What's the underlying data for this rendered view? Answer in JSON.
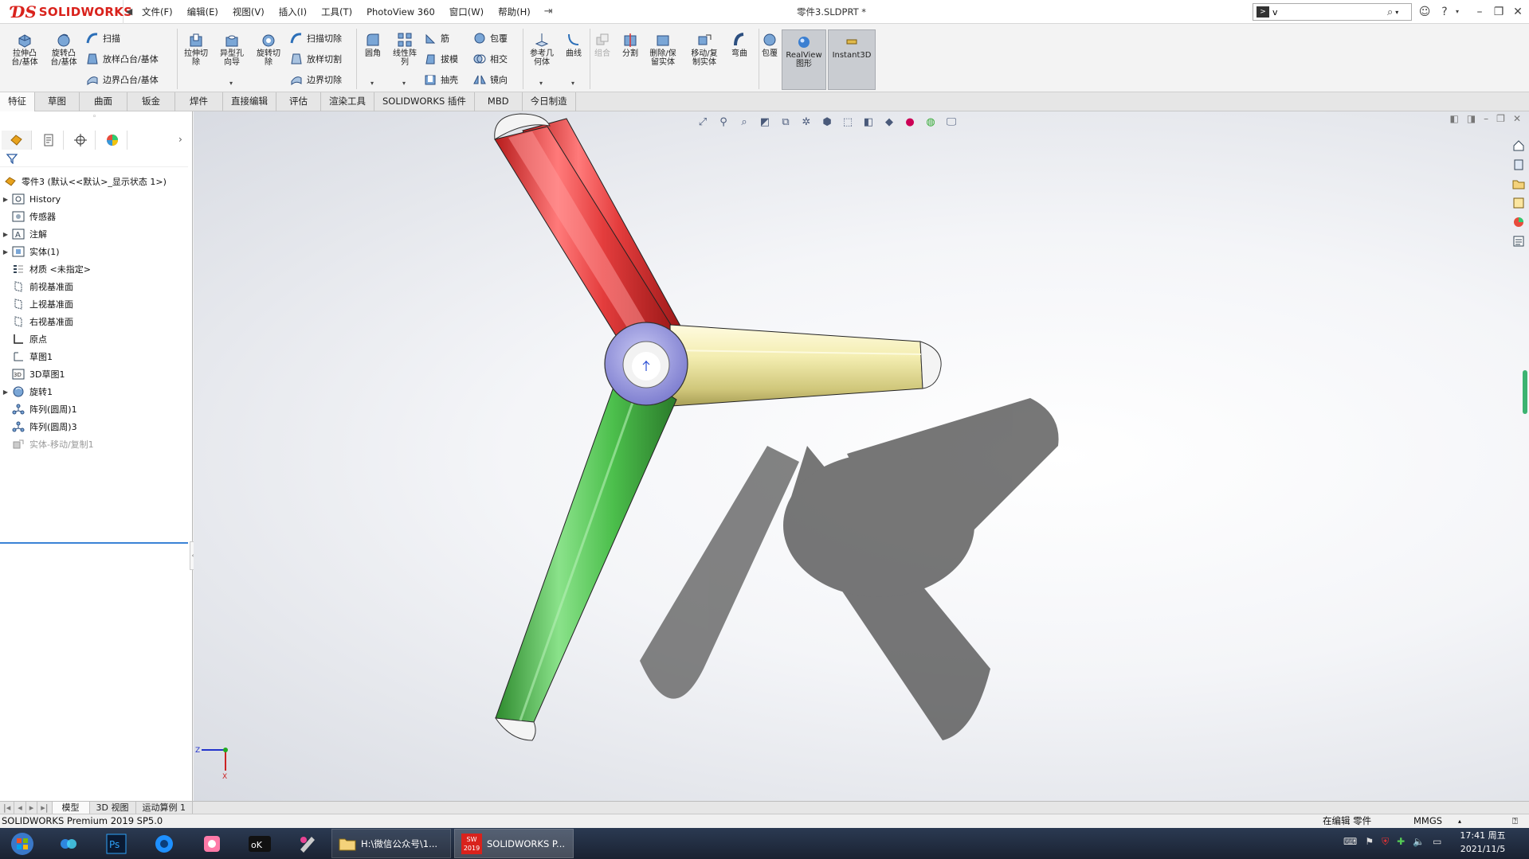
{
  "titlebar": {
    "logo": "SOLIDWORKS",
    "menus": [
      "文件(F)",
      "编辑(E)",
      "视图(V)",
      "插入(I)",
      "工具(T)",
      "PhotoView 360",
      "窗口(W)",
      "帮助(H)"
    ],
    "document_title": "零件3.SLDPRT *",
    "search_placeholder": "v",
    "brand_color": "#d9221c"
  },
  "commands": {
    "extrude_boss": "拉伸凸\n台/基体",
    "revolve_boss": "旋转凸\n台/基体",
    "sweep": "扫描",
    "loft_boss": "放样凸台/基体",
    "boundary_boss": "边界凸台/基体",
    "extrude_cut": "拉伸切\n除",
    "hole_wizard": "异型孔\n向导",
    "revolve_cut": "旋转切\n除",
    "swept_cut": "扫描切除",
    "lofted_cut": "放样切割",
    "boundary_cut": "边界切除",
    "fillet": "圆角",
    "linear_pattern": "线性阵\n列",
    "rib": "筋",
    "draft": "拔模",
    "shell": "抽壳",
    "wrap": "包覆",
    "intersect": "相交",
    "mirror": "镜向",
    "ref_geometry": "参考几\n何体",
    "curves": "曲线",
    "combine": "组合",
    "split": "分割",
    "delete_keep_body": "删除/保\n留实体",
    "move_copy_body": "移动/复\n制实体",
    "flex": "弯曲",
    "wrap2": "包覆",
    "realview": "RealView\n图形",
    "instant3d": "Instant3D"
  },
  "tabs": [
    "特征",
    "草图",
    "曲面",
    "钣金",
    "焊件",
    "直接编辑",
    "评估",
    "渲染工具",
    "SOLIDWORKS 插件",
    "MBD",
    "今日制造"
  ],
  "active_tab": "特征",
  "feature_tree": {
    "root": "零件3  (默认<<默认>_显示状态 1>)",
    "items": [
      {
        "label": "History",
        "icon": "history-icon",
        "expandable": true
      },
      {
        "label": "传感器",
        "icon": "sensor-icon",
        "expandable": false
      },
      {
        "label": "注解",
        "icon": "annotation-icon",
        "expandable": true
      },
      {
        "label": "实体(1)",
        "icon": "solid-bodies-icon",
        "expandable": true
      },
      {
        "label": "材质 <未指定>",
        "icon": "material-icon",
        "expandable": false
      },
      {
        "label": "前视基准面",
        "icon": "plane-icon",
        "expandable": false
      },
      {
        "label": "上视基准面",
        "icon": "plane-icon",
        "expandable": false
      },
      {
        "label": "右视基准面",
        "icon": "plane-icon",
        "expandable": false
      },
      {
        "label": "原点",
        "icon": "origin-icon",
        "expandable": false
      },
      {
        "label": "草图1",
        "icon": "sketch-icon",
        "expandable": false
      },
      {
        "label": "3D草图1",
        "icon": "3d-sketch-icon",
        "expandable": false
      },
      {
        "label": "旋转1",
        "icon": "revolve-icon",
        "expandable": true
      },
      {
        "label": "阵列(圆周)1",
        "icon": "circular-pattern-icon",
        "expandable": false
      },
      {
        "label": "阵列(圆周)3",
        "icon": "circular-pattern-icon",
        "expandable": false
      },
      {
        "label": "实体-移动/复制1",
        "icon": "move-body-icon",
        "expandable": false,
        "suppressed": true
      }
    ]
  },
  "model_tabs": [
    "模型",
    "3D 视图",
    "运动算例 1"
  ],
  "status": {
    "left": "SOLIDWORKS Premium 2019 SP5.0",
    "editing": "在编辑 零件",
    "units": "MMGS"
  },
  "taskbar": {
    "folder_window": "H:\\微信公众号\\1...",
    "solidworks_window": "SOLIDWORKS P...",
    "sw_badge": "2019",
    "time": "17:41 周五",
    "date": "2021/11/5"
  },
  "model_colors": {
    "red_arm": "#e84040",
    "yellow_arm": "#efe9a0",
    "green_arm": "#5cc55c",
    "hub": "#8f8fdc"
  },
  "triad": {
    "z": "Z",
    "x": "X"
  }
}
